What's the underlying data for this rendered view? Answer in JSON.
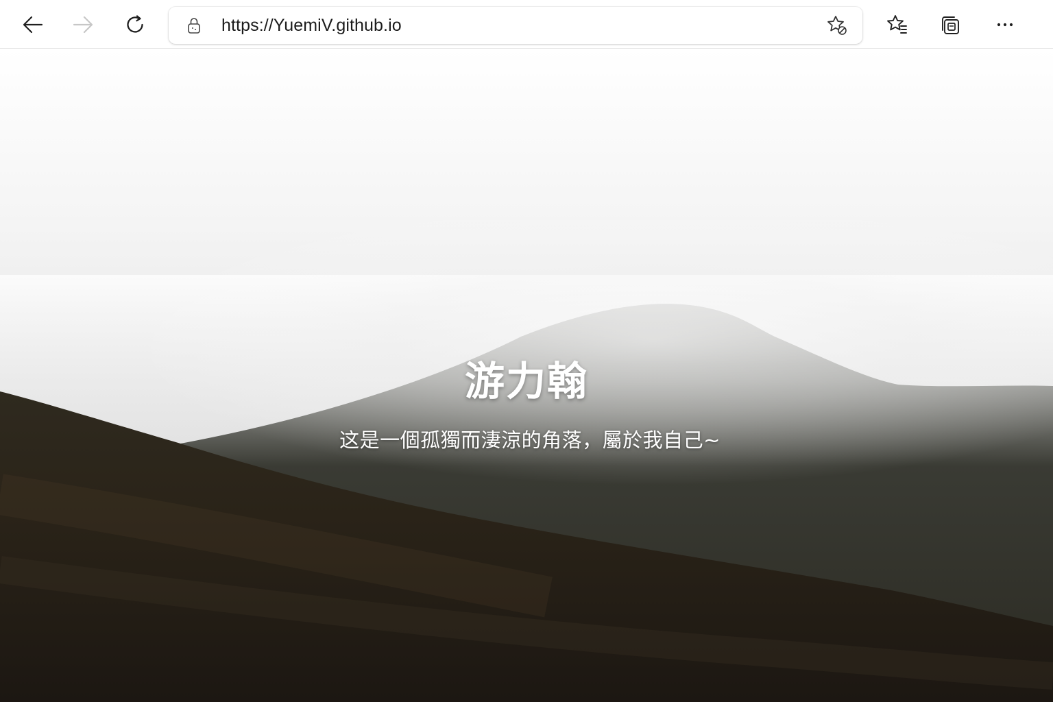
{
  "browser": {
    "url": "https://YuemiV.github.io",
    "back_label": "Back",
    "forward_label": "Forward",
    "refresh_label": "Refresh",
    "add_favorite_label": "Add this page to favorites",
    "favorites_label": "Favorites",
    "collections_label": "Collections",
    "more_label": "Settings and more",
    "icons": {
      "back": "arrow-left-icon",
      "forward": "arrow-right-icon",
      "refresh": "refresh-icon",
      "lock": "lock-icon",
      "add_favorite": "star-add-icon",
      "favorites": "favorites-list-icon",
      "collections": "collections-icon",
      "more": "ellipsis-icon"
    }
  },
  "page": {
    "title": "游力翰",
    "subtitle": "这是一個孤獨而淒涼的角落，屬於我自己~"
  },
  "colors": {
    "toolbar_bg": "#ffffff",
    "icon_active": "#1f1f1f",
    "icon_disabled": "#c7c7c7",
    "hero_text": "#ffffff"
  }
}
